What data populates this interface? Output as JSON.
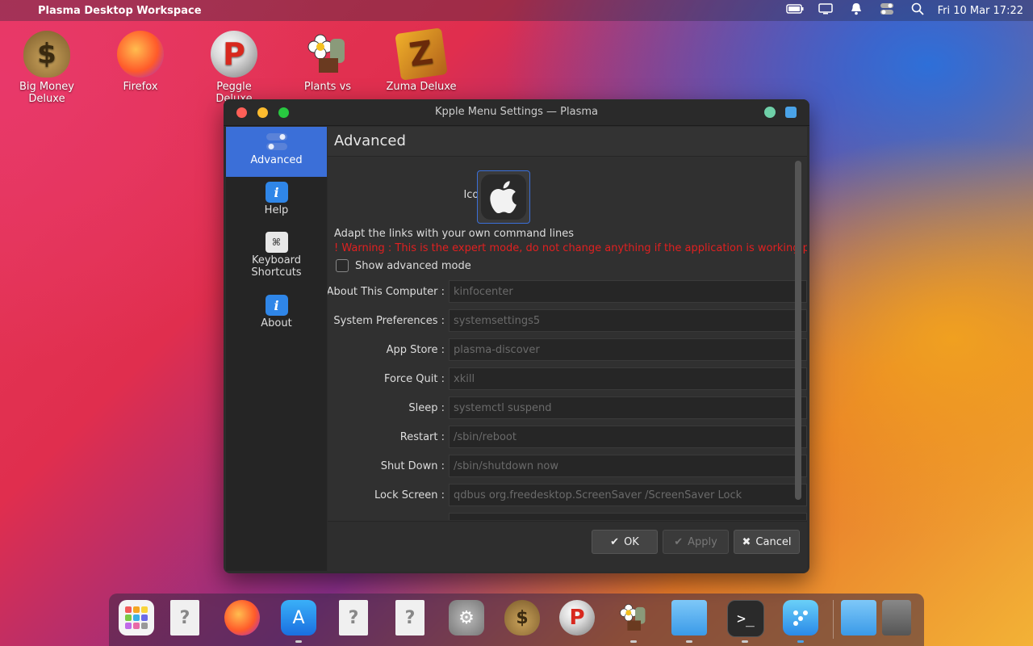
{
  "menubar": {
    "title": "Plasma Desktop Workspace",
    "clock": "Fri 10 Mar 17:22",
    "icons": [
      "battery-icon",
      "display-icon",
      "notification-bell-icon",
      "toggle-icon",
      "search-icon"
    ]
  },
  "desktop": {
    "icons": [
      {
        "label": "Big Money Deluxe",
        "icon": "money-bag-icon"
      },
      {
        "label": "Firefox",
        "icon": "firefox-icon"
      },
      {
        "label": "Peggle Deluxe",
        "icon": "peggle-icon"
      },
      {
        "label": "Plants vs",
        "icon": "plants-icon"
      },
      {
        "label": "Zuma Deluxe",
        "icon": "zuma-icon"
      }
    ]
  },
  "window": {
    "title": "Kpple Menu Settings — Plasma",
    "sidebar": [
      {
        "label": "Advanced",
        "icon": "toggles-icon",
        "active": true
      },
      {
        "label": "Help",
        "icon": "info-icon"
      },
      {
        "label": "Keyboard Shortcuts",
        "icon": "keyboard-icon"
      },
      {
        "label": "About",
        "icon": "info-icon"
      }
    ],
    "heading": "Advanced",
    "icon_label": "Icon:",
    "adapt_text": "Adapt the links with your own command lines",
    "warning_text": "! Warning : This is the expert mode, do not change anything if the application is working properly !",
    "checkbox_label": "Show advanced mode",
    "fields": [
      {
        "label": "About This Computer :",
        "value": "kinfocenter"
      },
      {
        "label": "System Preferences :",
        "value": "systemsettings5"
      },
      {
        "label": "App Store :",
        "value": "plasma-discover"
      },
      {
        "label": "Force Quit :",
        "value": "xkill"
      },
      {
        "label": "Sleep :",
        "value": "systemctl suspend"
      },
      {
        "label": "Restart :",
        "value": "/sbin/reboot"
      },
      {
        "label": "Shut Down :",
        "value": "/sbin/shutdown now"
      },
      {
        "label": "Lock Screen :",
        "value": "qdbus org.freedesktop.ScreenSaver /ScreenSaver Lock"
      }
    ],
    "buttons": {
      "ok": "OK",
      "apply": "Apply",
      "cancel": "Cancel"
    }
  },
  "dock": {
    "items": [
      "launcher-grid-icon",
      "unknown-file-icon",
      "firefox-icon",
      "app-store-icon",
      "unknown-file-icon",
      "unknown-file-icon",
      "settings-gear-icon",
      "money-bag-icon",
      "peggle-icon",
      "plants-icon",
      "folder-icon",
      "terminal-icon",
      "discover-icon",
      "folder-icon",
      "trash-icon"
    ]
  },
  "colors": {
    "accent": "#3b6fd8",
    "warning": "#e02020",
    "close": "#ff5f57",
    "minimize": "#febc2e",
    "maximize": "#28c840"
  }
}
